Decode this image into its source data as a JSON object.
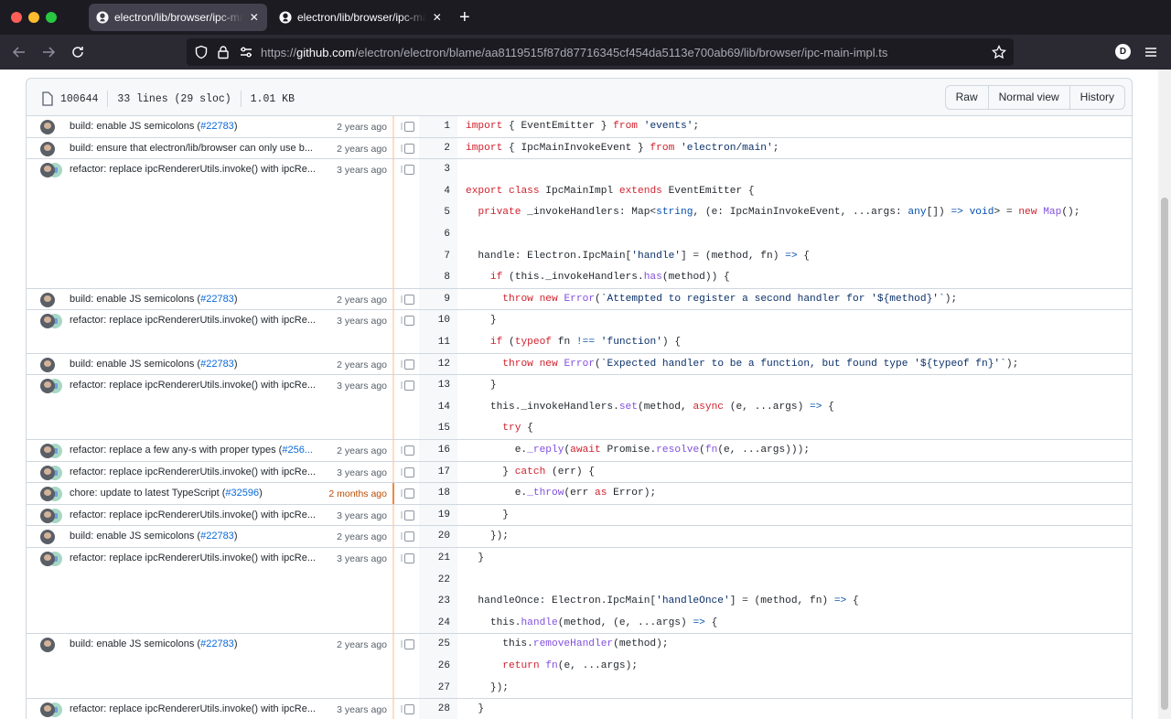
{
  "browser": {
    "tabs": [
      {
        "title": "electron/lib/browser/ipc-main-impl.ts",
        "active": true
      },
      {
        "title": "electron/lib/browser/ipc-main-impl.ts",
        "active": false
      }
    ],
    "url_prefix": "https://",
    "url_host": "github.com",
    "url_path": "/electron/electron/blame/aa8119515f87d87716345cf454da5113e700ab69/lib/browser/ipc-main-impl.ts",
    "profile_initial": "D"
  },
  "file": {
    "mode": "100644",
    "lines": "33 lines (29 sloc)",
    "size": "1.01 KB",
    "buttons": {
      "raw": "Raw",
      "normal": "Normal view",
      "history": "History"
    }
  },
  "hunks": [
    {
      "msg": "build: enable JS semicolons",
      "pr": "#22783",
      "date": "2 years ago",
      "bot": false,
      "recent": false
    },
    {
      "msg": "build: ensure that electron/lib/browser can only use b...",
      "pr": "",
      "date": "2 years ago",
      "bot": false,
      "recent": false
    },
    {
      "msg": "refactor: replace ipcRendererUtils.invoke() with ipcRe...",
      "pr": "",
      "date": "3 years ago",
      "bot": true,
      "recent": false
    },
    {
      "msg": "build: enable JS semicolons",
      "pr": "#22783",
      "date": "2 years ago",
      "bot": false,
      "recent": false
    },
    {
      "msg": "refactor: replace ipcRendererUtils.invoke() with ipcRe...",
      "pr": "",
      "date": "3 years ago",
      "bot": true,
      "recent": false
    },
    {
      "msg": "build: enable JS semicolons",
      "pr": "#22783",
      "date": "2 years ago",
      "bot": false,
      "recent": false
    },
    {
      "msg": "refactor: replace ipcRendererUtils.invoke() with ipcRe...",
      "pr": "",
      "date": "3 years ago",
      "bot": true,
      "recent": false
    },
    {
      "msg": "refactor: replace a few any-s with proper types",
      "pr": "#256...",
      "date": "2 years ago",
      "bot": true,
      "recent": false
    },
    {
      "msg": "refactor: replace ipcRendererUtils.invoke() with ipcRe...",
      "pr": "",
      "date": "3 years ago",
      "bot": true,
      "recent": false
    },
    {
      "msg": "chore: update to latest TypeScript",
      "pr": "#32596",
      "date": "2 months ago",
      "bot": true,
      "recent": true
    },
    {
      "msg": "refactor: replace ipcRendererUtils.invoke() with ipcRe...",
      "pr": "",
      "date": "3 years ago",
      "bot": true,
      "recent": false
    },
    {
      "msg": "build: enable JS semicolons",
      "pr": "#22783",
      "date": "2 years ago",
      "bot": false,
      "recent": false
    },
    {
      "msg": "refactor: replace ipcRendererUtils.invoke() with ipcRe...",
      "pr": "",
      "date": "3 years ago",
      "bot": true,
      "recent": false
    },
    {
      "msg": "build: enable JS semicolons",
      "pr": "#22783",
      "date": "2 years ago",
      "bot": false,
      "recent": false
    },
    {
      "msg": "refactor: replace ipcRendererUtils.invoke() with ipcRe...",
      "pr": "",
      "date": "3 years ago",
      "bot": true,
      "recent": false
    }
  ],
  "hunk_line_counts": [
    1,
    1,
    6,
    1,
    2,
    1,
    3,
    1,
    1,
    1,
    1,
    1,
    4,
    3,
    1
  ],
  "code_lines": [
    "import { EventEmitter } from 'events';",
    "import { IpcMainInvokeEvent } from 'electron/main';",
    "",
    "export class IpcMainImpl extends EventEmitter {",
    "  private _invokeHandlers: Map<string, (e: IpcMainInvokeEvent, ...args: any[]) => void> = new Map();",
    "",
    "  handle: Electron.IpcMain['handle'] = (method, fn) => {",
    "    if (this._invokeHandlers.has(method)) {",
    "      throw new Error(`Attempted to register a second handler for '${method}'`);",
    "    }",
    "    if (typeof fn !== 'function') {",
    "      throw new Error(`Expected handler to be a function, but found type '${typeof fn}'`);",
    "    }",
    "    this._invokeHandlers.set(method, async (e, ...args) => {",
    "      try {",
    "        e._reply(await Promise.resolve(fn(e, ...args)));",
    "      } catch (err) {",
    "        e._throw(err as Error);",
    "      }",
    "    });",
    "  }",
    "",
    "  handleOnce: Electron.IpcMain['handleOnce'] = (method, fn) => {",
    "    this.handle(method, (e, ...args) => {",
    "      this.removeHandler(method);",
    "      return fn(e, ...args);",
    "    });",
    "  }"
  ],
  "colors": {
    "keyword": "#cf222e",
    "string": "#0a3069",
    "function": "#8250df",
    "constant": "#0550ae",
    "link": "#0969da",
    "recent": "#bc4c00"
  },
  "icons": [
    "github-icon",
    "back-icon",
    "forward-icon",
    "reload-icon",
    "shield-icon",
    "lock-icon",
    "permissions-icon",
    "star-icon",
    "menu-icon",
    "file-icon"
  ]
}
